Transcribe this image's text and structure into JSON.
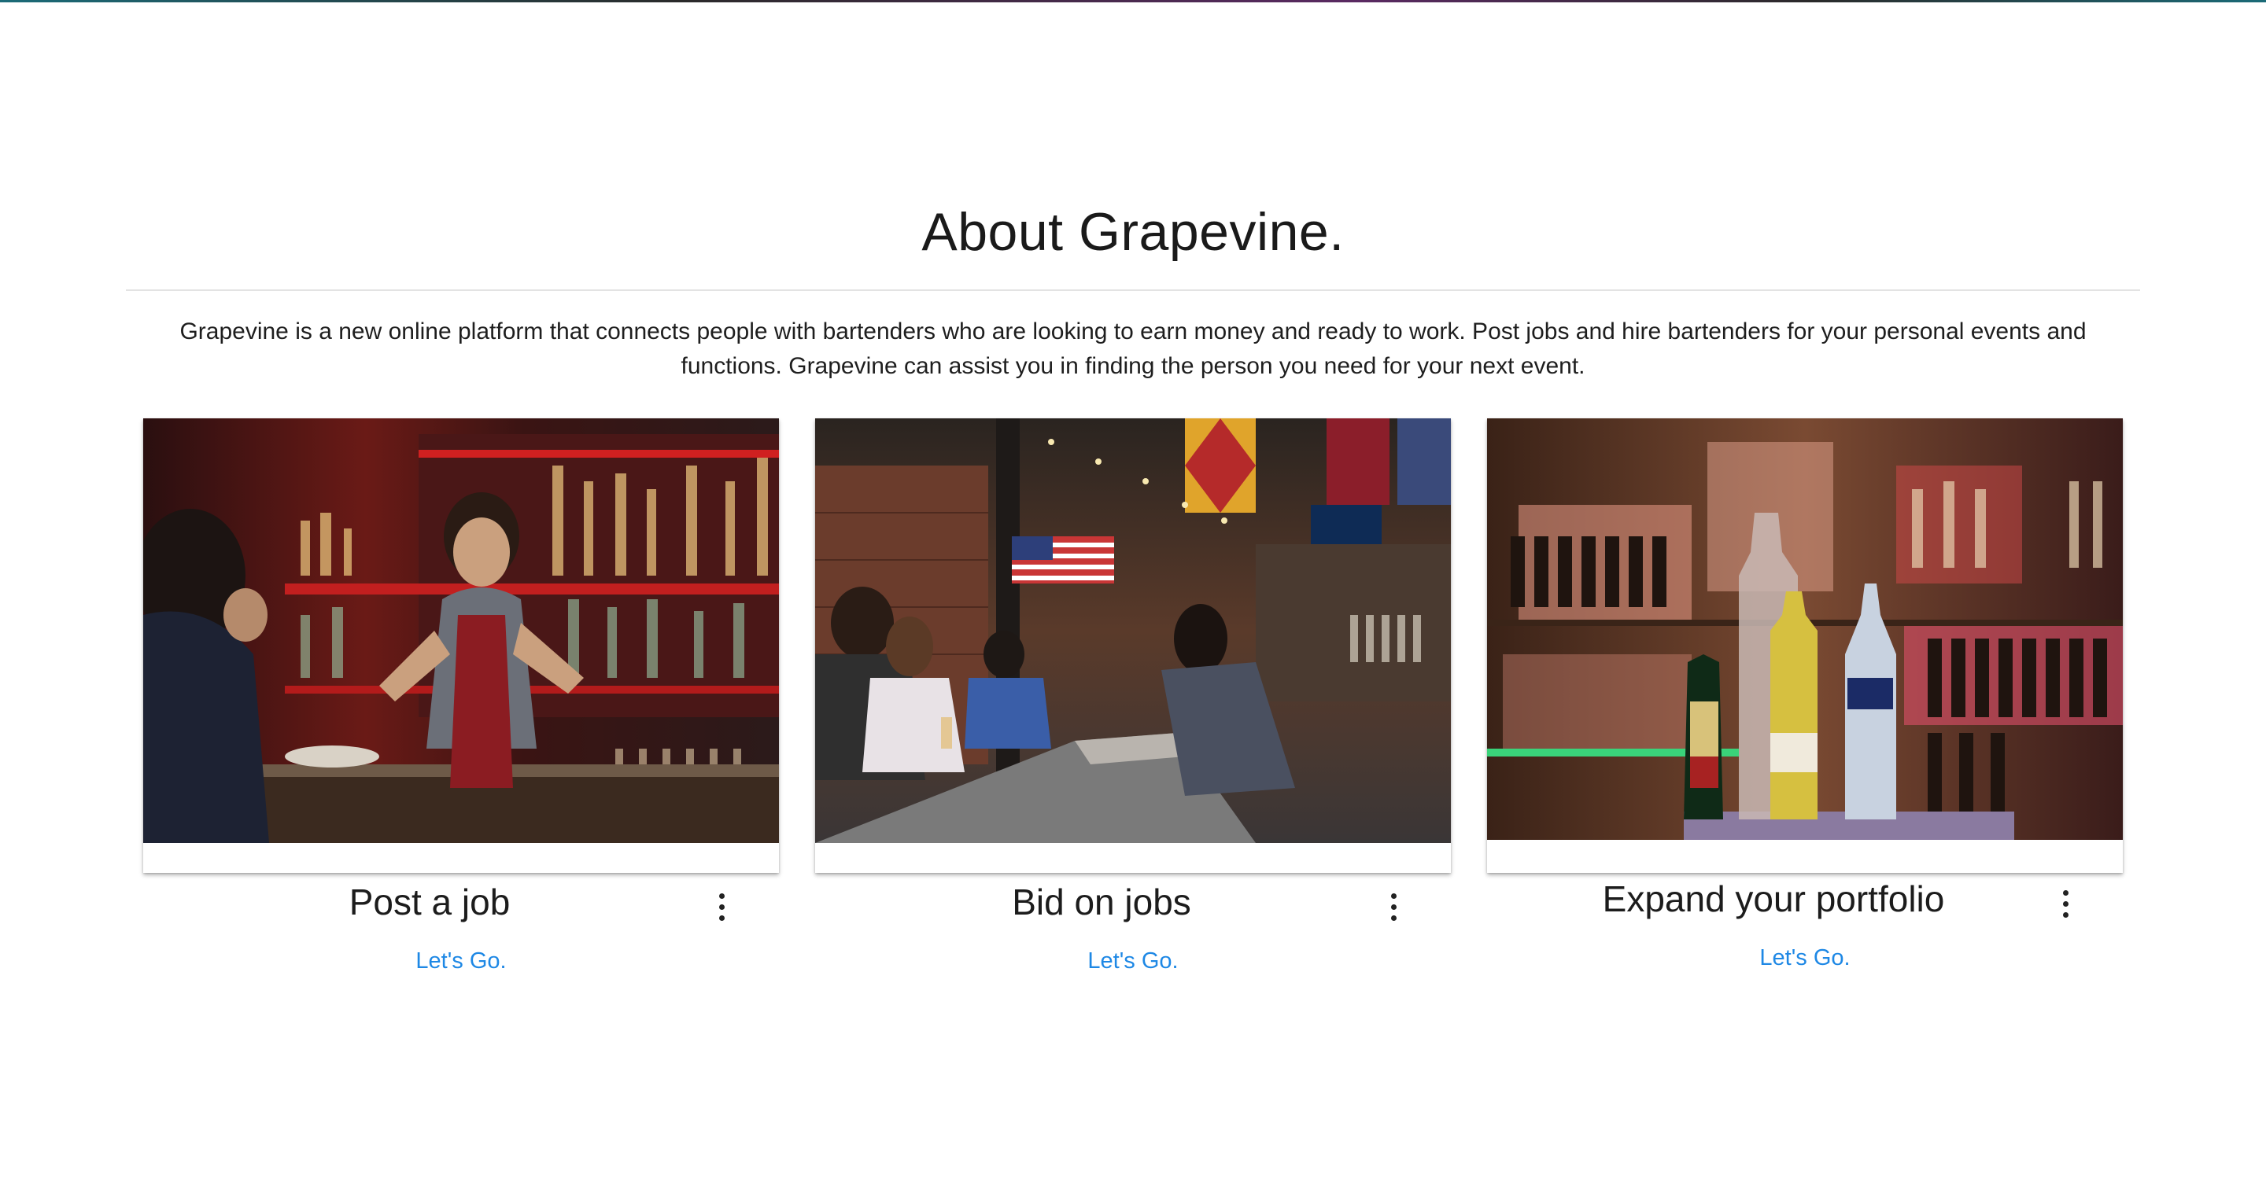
{
  "about": {
    "title": "About Grapevine.",
    "description": "Grapevine is a new online platform that connects people with bartenders who are looking to earn money and ready to work. Post jobs and hire bartenders for your personal events and functions. Grapevine can assist you in finding the person you need for your next event."
  },
  "cards": [
    {
      "title": "Post a job",
      "link": "Let's Go.",
      "image_icon": "bartender-photo"
    },
    {
      "title": "Bid on jobs",
      "link": "Let's Go.",
      "image_icon": "bar-interior-photo"
    },
    {
      "title": "Expand your portfolio",
      "link": "Let's Go.",
      "image_icon": "liquor-bottles-photo"
    }
  ],
  "colors": {
    "link": "#1e88e5",
    "text": "#212121",
    "divider": "#e3e3e3"
  }
}
